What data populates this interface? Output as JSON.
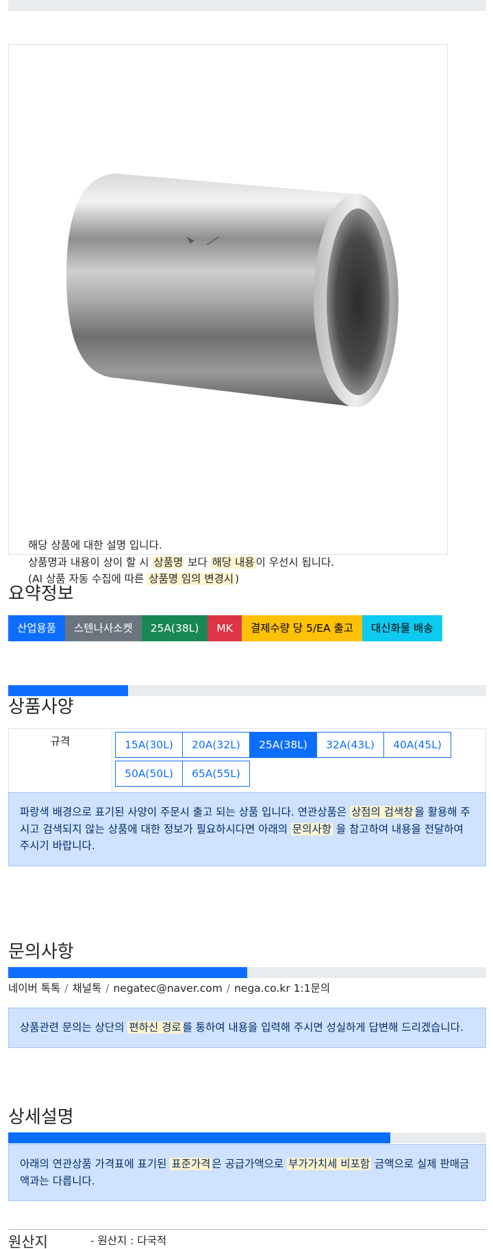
{
  "product_note": {
    "line1": "해당 상품에 대한 설명 입니다.",
    "line2_a": "상품명과 내용이 상이 할 시 ",
    "line2_hl1": "상품명",
    "line2_b": " 보다 ",
    "line2_hl2": "해당 내용",
    "line2_c": "이 우선시 됩니다.",
    "line3_a": "(AI 상품 자동 수집에 따른 ",
    "line3_hl": "상품명 임의 변경시",
    "line3_b": ")"
  },
  "summary": {
    "title": "요약정보",
    "badges": [
      "산업용품",
      "스텐나사소켓",
      "25A(38L)",
      "MK",
      "결제수량 당 5/EA 출고",
      "대신화물 배송"
    ]
  },
  "spec": {
    "title": "상품사양",
    "progress": 0.25,
    "label": "규격",
    "options": [
      "15A(30L)",
      "20A(32L)",
      "25A(38L)",
      "32A(43L)",
      "40A(45L)",
      "50A(50L)",
      "65A(55L)"
    ],
    "selected": "25A(38L)",
    "notice_a": "파랑색 배경으로 표기된 사양이 주문시 출고 되는 상품 입니다. 연관상품은 ",
    "notice_hl1": "상점의 검색창",
    "notice_b": "을 활용해 주시고 검색되지 않는 상품에 대한 정보가 필요하시다면 아래의 ",
    "notice_hl2": "문의사항",
    "notice_c": " 을 참고하여 내용을 전달하여 주시기 바랍니다."
  },
  "inquiry": {
    "title": "문의사항",
    "progress": 0.5,
    "contacts": [
      "네이버 톡톡",
      "채널톡",
      "negatec@naver.com",
      "nega.co.kr 1:1문의"
    ],
    "notice_a": "상품관련 문의는 상단의 ",
    "notice_hl": "편하신 경로",
    "notice_b": "를 통하여 내용을 입력해 주시면 성실하게 답변해 드리겠습니다."
  },
  "detail": {
    "title": "상세설명",
    "progress": 0.8,
    "notice_a": "아래의 연관상품 가격표에 표기된 ",
    "notice_hl1": "표준가격",
    "notice_b": "은 공급가액으로 ",
    "notice_hl2": "부가가치세 비포함",
    "notice_c": " 금액으로 실제 판매금액과는 다릅니다."
  },
  "origin": {
    "label": "원산지",
    "value": "- 원산지 : 다국적"
  },
  "colors": {
    "primary": "#0d6efd",
    "secondary": "#6c757d",
    "success": "#198754",
    "danger": "#dc3545",
    "warning": "#ffc107",
    "info": "#0dcaf0",
    "alert_bg": "#cfe2ff",
    "highlight": "#fff3cd"
  }
}
